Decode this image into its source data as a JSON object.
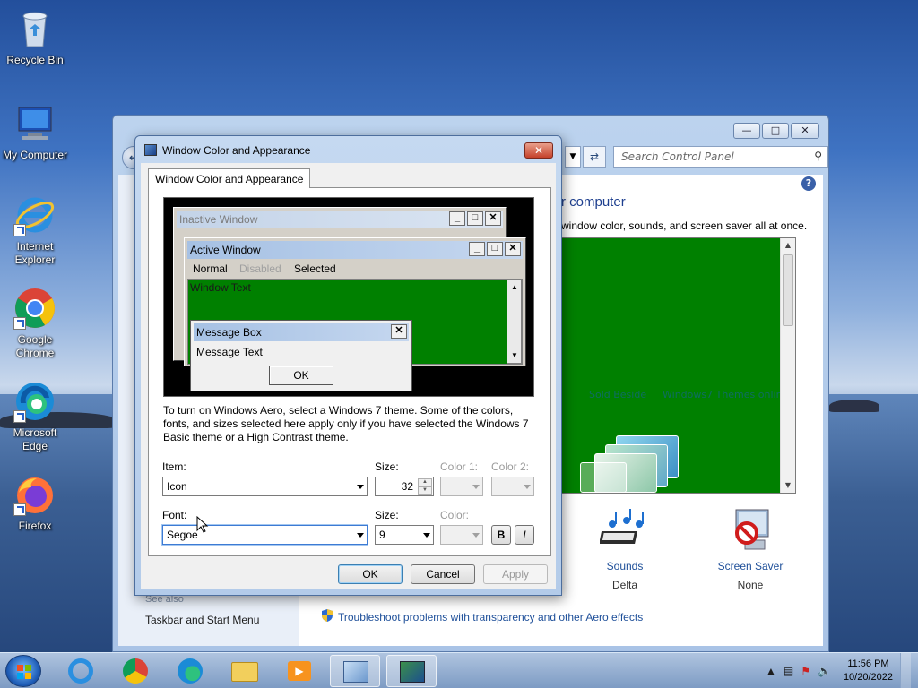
{
  "desktop": {
    "icons": [
      {
        "label": "Recycle Bin",
        "icon": "recycle-bin-icon"
      },
      {
        "label": "My Computer",
        "icon": "computer-icon"
      },
      {
        "label": "Internet Explorer",
        "icon": "internet-explorer-icon"
      },
      {
        "label": "Google Chrome",
        "icon": "chrome-icon"
      },
      {
        "label": "Microsoft Edge",
        "icon": "edge-icon"
      },
      {
        "label": "Firefox",
        "icon": "firefox-icon"
      }
    ]
  },
  "control_panel": {
    "search_placeholder": "Search Control Panel",
    "heading": "r computer",
    "subheading": "window color, sounds, and screen saver all at once.",
    "theme_links": [
      "Sold Beside",
      "Windows7 Themes online"
    ],
    "items": [
      {
        "label": "Sounds",
        "value": "Delta",
        "icon": "sounds-icon"
      },
      {
        "label": "Screen Saver",
        "value": "None",
        "icon": "screen-saver-icon"
      }
    ],
    "see_also": "See also",
    "taskbar_link": "Taskbar and Start Menu",
    "troubleshoot_link": "Troubleshoot problems with transparency and other Aero effects"
  },
  "dialog": {
    "title": "Window Color and Appearance",
    "tab": "Window Color and Appearance",
    "preview": {
      "inactive_title": "Inactive Window",
      "active_title": "Active Window",
      "menu_normal": "Normal",
      "menu_disabled": "Disabled",
      "menu_selected": "Selected",
      "window_text": "Window Text",
      "msgbox_title": "Message Box",
      "msgbox_text": "Message Text",
      "msgbox_ok": "OK"
    },
    "description": "To turn on Windows Aero, select a Windows 7 theme.  Some of the colors, fonts, and sizes selected here apply only if you have selected the Windows 7 Basic theme or a High Contrast theme.",
    "item_label": "Item:",
    "item_value": "Icon",
    "size_label": "Size:",
    "item_size": "32",
    "color1_label": "Color 1:",
    "color2_label": "Color 2:",
    "font_label": "Font:",
    "font_value": "Segoe",
    "font_size_label": "Size:",
    "font_size": "9",
    "font_color_label": "Color:",
    "bold_label": "B",
    "italic_label": "I",
    "ok": "OK",
    "cancel": "Cancel",
    "apply": "Apply"
  },
  "taskbar": {
    "time": "11:56 PM",
    "date": "10/20/2022"
  },
  "colors": {
    "preview_green": "#008000",
    "link_blue": "#1e4f99"
  }
}
